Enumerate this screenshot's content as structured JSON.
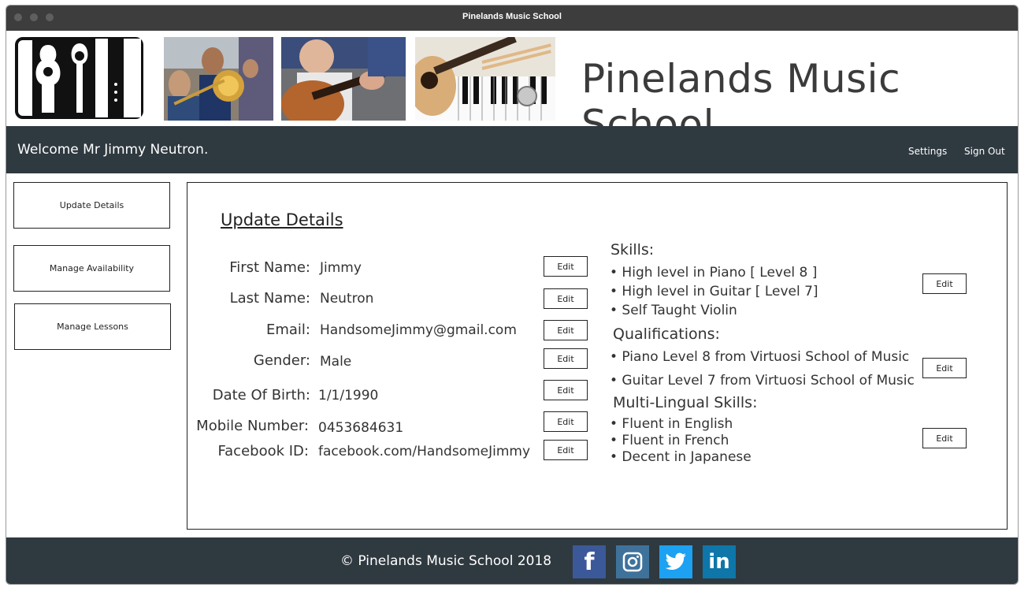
{
  "window": {
    "title": "Pinelands Music School"
  },
  "header": {
    "school_name": "Pinelands Music School"
  },
  "nav": {
    "welcome": "Welcome Mr Jimmy Neutron.",
    "settings": "Settings",
    "sign_out": "Sign Out"
  },
  "sidebar": {
    "items": [
      {
        "label": "Update Details"
      },
      {
        "label": "Manage Availability"
      },
      {
        "label": "Manage Lessons"
      }
    ]
  },
  "main": {
    "title": "Update Details",
    "edit_label": "Edit",
    "fields": [
      {
        "label": "First Name:",
        "value": "Jimmy"
      },
      {
        "label": "Last Name:",
        "value": "Neutron"
      },
      {
        "label": "Email:",
        "value": "HandsomeJimmy@gmail.com"
      },
      {
        "label": "Gender:",
        "value": "Male"
      },
      {
        "label": "Date Of Birth:",
        "value": "1/1/1990"
      },
      {
        "label": "Mobile Number:",
        "value": "0453684631"
      },
      {
        "label": "Facebook ID:",
        "value": "facebook.com/HandsomeJimmy"
      }
    ],
    "skills": {
      "heading": "Skills:",
      "items": [
        "• High level in Piano [ Level 8 ]",
        "• High level in Guitar [ Level 7]",
        "• Self Taught Violin"
      ]
    },
    "qualifications": {
      "heading": "Qualifications:",
      "items": [
        "• Piano Level 8 from Virtuosi School of Music",
        "• Guitar Level 7 from Virtuosi School of Music"
      ]
    },
    "languages": {
      "heading": "Multi-Lingual Skills:",
      "items": [
        "• Fluent in English",
        "• Fluent in French",
        "• Decent in Japanese"
      ]
    }
  },
  "footer": {
    "copyright": "© Pinelands Music School   2018"
  },
  "social": [
    {
      "icon": "facebook-icon",
      "glyph": "f",
      "color": "#3b5998"
    },
    {
      "icon": "instagram-icon",
      "glyph": "",
      "color": "#3f729b"
    },
    {
      "icon": "twitter-icon",
      "glyph": "",
      "color": "#1da1f2"
    },
    {
      "icon": "linkedin-icon",
      "glyph": "in",
      "color": "#0e76a8"
    }
  ]
}
